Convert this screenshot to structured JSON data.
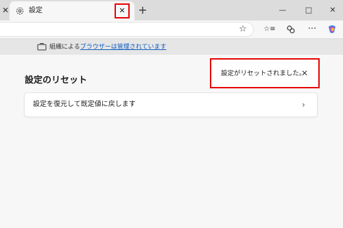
{
  "tab": {
    "title": "設定",
    "close_glyph": "✕",
    "left_partial_close_glyph": "✕"
  },
  "tabbar": {
    "new_tab_glyph": "+"
  },
  "window": {
    "minimize_glyph": "—",
    "maximize_glyph": "□",
    "close_glyph": "✕"
  },
  "toolbar": {
    "favorite_glyph": "☆",
    "favorites_glyph": "☆≡",
    "more_glyph": "···"
  },
  "managed": {
    "prefix": "組織による",
    "link": "ブラウザーは管理されています"
  },
  "content": {
    "section_title": "設定のリセット",
    "reset_item_label": "設定を復元して既定値に戻します",
    "chevron_glyph": "›"
  },
  "toast": {
    "message": "設定がリセットされました。",
    "close_glyph": "✕"
  },
  "colors": {
    "highlight": "#e60000",
    "link": "#0f5cc0",
    "tabbar_bg": "#dcdcdc",
    "page_bg": "#f7f7f7"
  },
  "icons": [
    "close-icon",
    "gear-icon",
    "plus-icon",
    "minimize-icon",
    "maximize-icon",
    "star-icon",
    "favorites-icon",
    "collections-icon",
    "more-icon",
    "copilot-icon",
    "briefcase-icon",
    "chevron-right-icon"
  ]
}
